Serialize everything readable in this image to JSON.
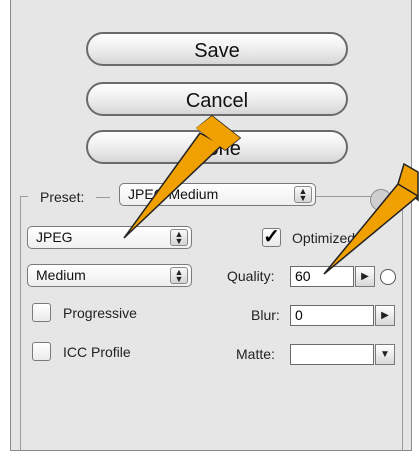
{
  "buttons": {
    "save": "Save",
    "cancel": "Cancel",
    "done": "Done"
  },
  "preset": {
    "label": "Preset:",
    "value": "JPEG Medium"
  },
  "format": {
    "value": "JPEG"
  },
  "quality_preset": {
    "value": "Medium"
  },
  "optimized": {
    "label": "Optimized",
    "checked": true
  },
  "progressive": {
    "label": "Progressive",
    "checked": false
  },
  "icc_profile": {
    "label": "ICC Profile",
    "checked": false
  },
  "quality": {
    "label": "Quality:",
    "value": "60"
  },
  "blur": {
    "label": "Blur:",
    "value": "0"
  },
  "matte": {
    "label": "Matte:",
    "value": ""
  },
  "colors": {
    "panel": "#e6e6e6",
    "annotation_arrow": "#f0a000"
  }
}
